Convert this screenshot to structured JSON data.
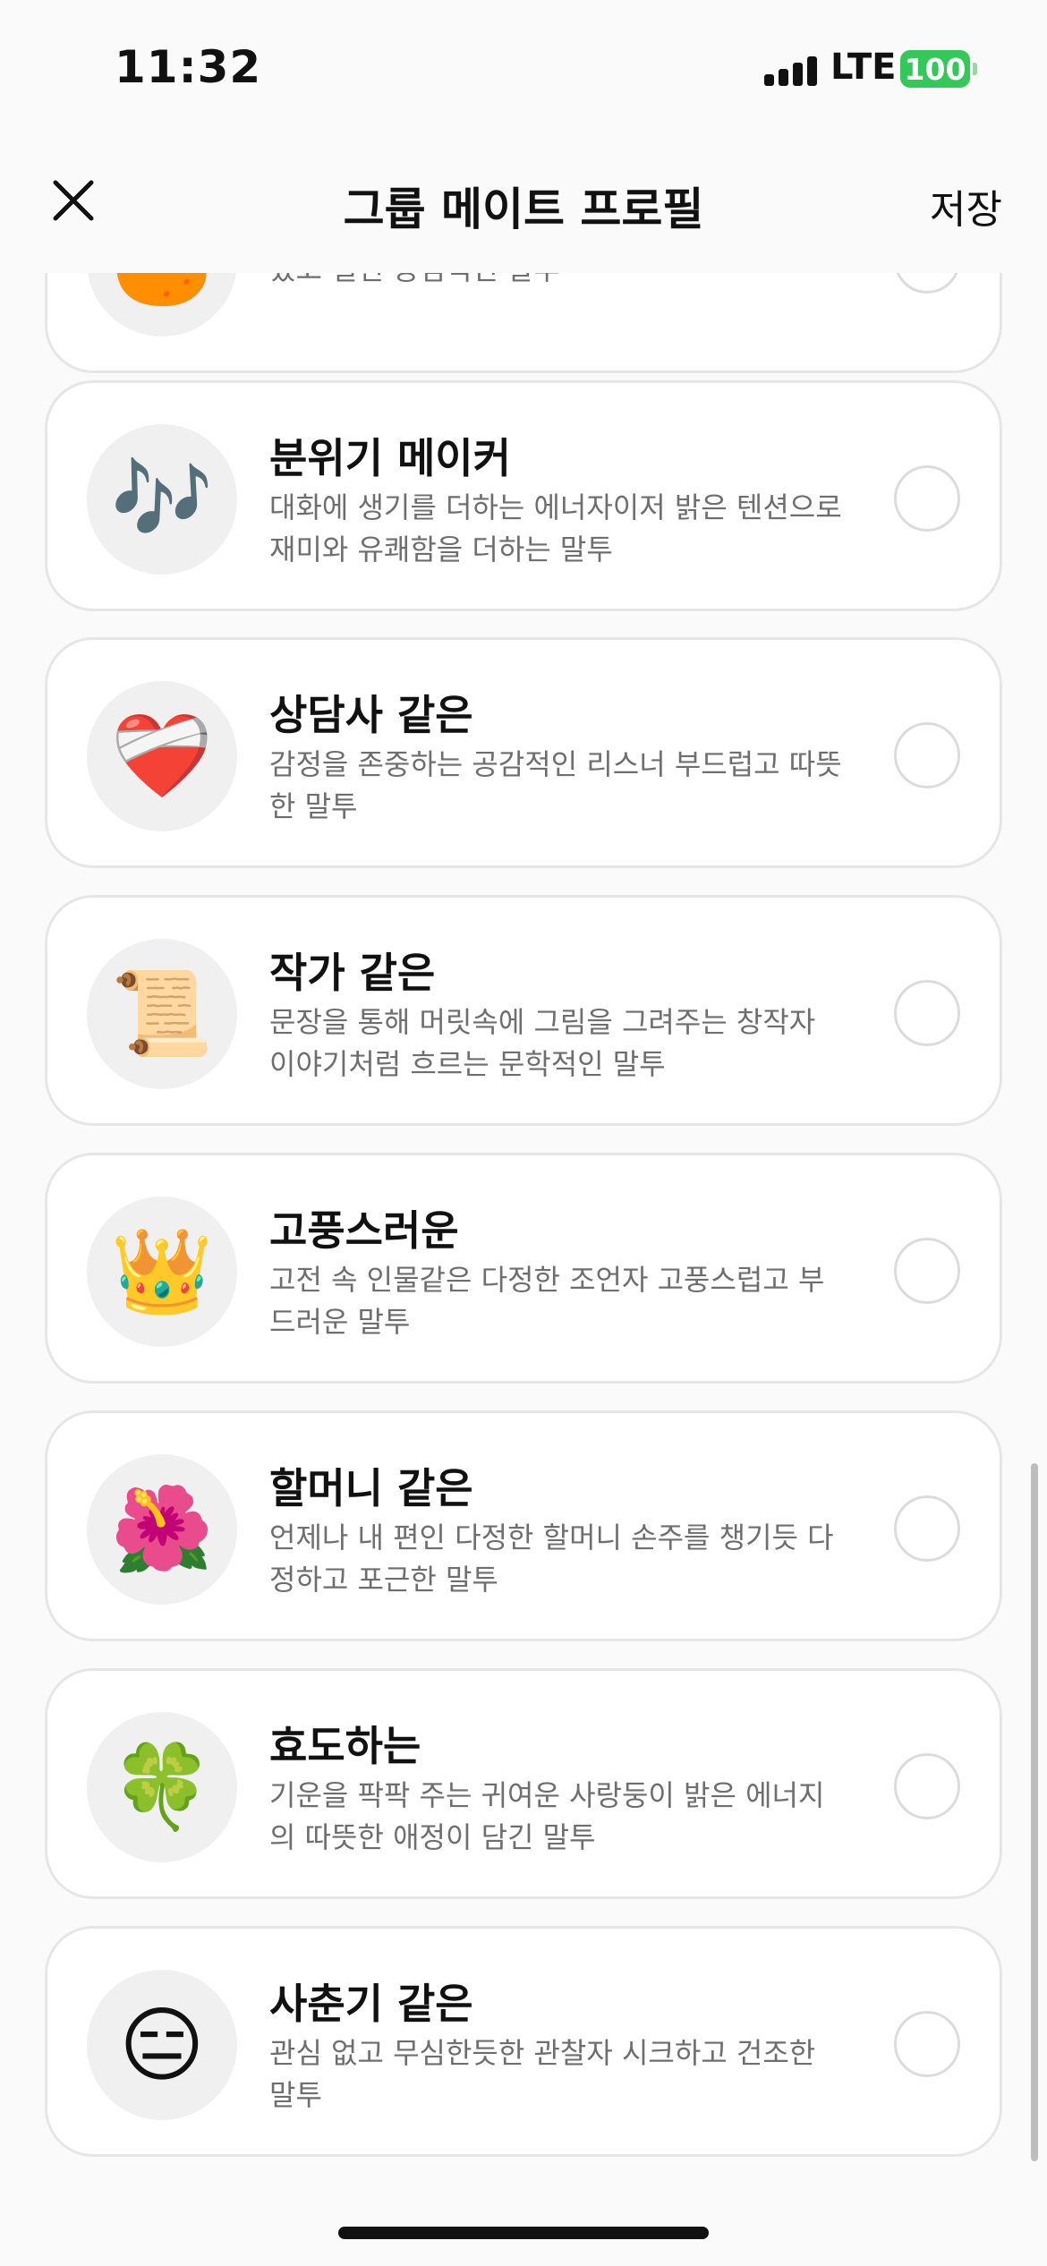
{
  "status_bar": {
    "time": "11:32",
    "network": "LTE",
    "battery": "100"
  },
  "nav": {
    "title": "그룹 메이트 프로필",
    "save_label": "저장"
  },
  "colors": {
    "battery": "#34c759",
    "card_border": "#e6e6e6",
    "avatar_bg": "#f0f0f0"
  },
  "cards": [
    {
      "title": "",
      "icon": "🍊",
      "icon_name": "orange-icon",
      "desc": "있고 실천 중심적인 말투",
      "selected": false
    },
    {
      "title": "분위기 메이커",
      "icon": "🎶",
      "icon_name": "music-notes-icon",
      "desc": "대화에 생기를 더하는 에너자이저 밝은 텐션으로 재미와 유쾌함을 더하는 말투",
      "selected": false
    },
    {
      "title": "상담사 같은",
      "icon": "❤️‍🩹",
      "icon_name": "mending-heart-icon",
      "desc": "감정을 존중하는 공감적인 리스너 부드럽고 따뜻한 말투",
      "selected": false
    },
    {
      "title": "작가 같은",
      "icon": "📜",
      "icon_name": "scroll-icon",
      "desc": "문장을 통해 머릿속에 그림을 그려주는 창작자 이야기처럼 흐르는 문학적인 말투",
      "selected": false
    },
    {
      "title": "고풍스러운",
      "icon": "👑",
      "icon_name": "crown-icon",
      "desc": "고전 속 인물같은 다정한 조언자 고풍스럽고 부드러운 말투",
      "selected": false
    },
    {
      "title": "할머니 같은",
      "icon": "🌺",
      "icon_name": "hibiscus-icon",
      "desc": "언제나 내 편인 다정한 할머니 손주를 챙기듯 다정하고 포근한 말투",
      "selected": false
    },
    {
      "title": "효도하는",
      "icon": "🍀",
      "icon_name": "four-leaf-clover-icon",
      "desc": "기운을 팍팍 주는 귀여운 사랑둥이 밝은 에너지의 따뜻한 애정이 담긴 말투",
      "selected": false
    },
    {
      "title": "사춘기 같은",
      "icon": "😑",
      "icon_name": "expressionless-face-icon",
      "desc": "관심 없고 무심한듯한 관찰자 시크하고 건조한 말투",
      "selected": false
    }
  ]
}
